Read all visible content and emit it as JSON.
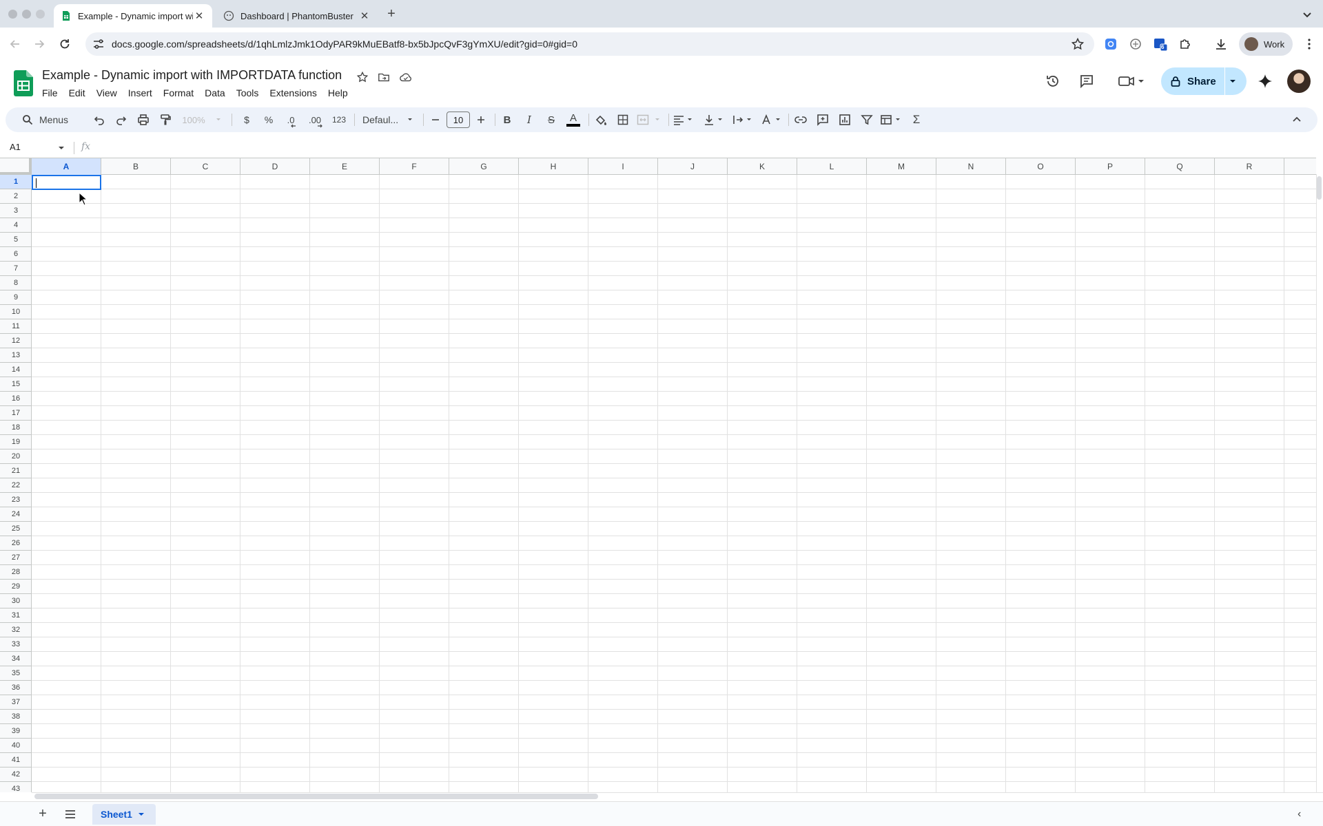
{
  "browser": {
    "tabs": [
      {
        "title": "Example - Dynamic import with IMPORTDATA function",
        "favicon": "sheets-favicon",
        "active": true
      },
      {
        "title": "Dashboard | PhantomBuster",
        "favicon": "phantombuster-favicon",
        "active": false
      }
    ],
    "new_tab_label": "+",
    "url": "docs.google.com/spreadsheets/d/1qhLmlzJmk1OdyPAR9kMuEBatf8-bx5bJpcQvF3gYmXU/edit?gid=0#gid=0",
    "profile_label": "Work",
    "extension_badge": "6"
  },
  "doc": {
    "title": "Example - Dynamic import with IMPORTDATA function",
    "menus": [
      "File",
      "Edit",
      "View",
      "Insert",
      "Format",
      "Data",
      "Tools",
      "Extensions",
      "Help"
    ],
    "share_label": "Share"
  },
  "toolbar": {
    "search_menus": "Menus",
    "zoom": "100%",
    "currency": "$",
    "percent": "%",
    "decrease_decimal": ".0",
    "increase_decimal": ".00",
    "number_format": "123",
    "font": "Defaul...",
    "font_size": "10",
    "bold": "B",
    "italic": "I",
    "strikethrough": "S",
    "text_color_letter": "A",
    "sum": "Σ"
  },
  "formula_bar": {
    "cell_ref": "A1",
    "fx_label": "fx"
  },
  "grid": {
    "columns": [
      "A",
      "B",
      "C",
      "D",
      "E",
      "F",
      "G",
      "H",
      "I",
      "J",
      "K",
      "L",
      "M",
      "N",
      "O",
      "P",
      "Q",
      "R"
    ],
    "rows": [
      "1",
      "2",
      "3",
      "4",
      "5",
      "6",
      "7",
      "8",
      "9",
      "10",
      "11",
      "12",
      "13",
      "14",
      "15",
      "16",
      "17",
      "18",
      "19",
      "20",
      "21",
      "22",
      "23",
      "24",
      "25",
      "26",
      "27",
      "28",
      "29",
      "30",
      "31",
      "32",
      "33",
      "34",
      "35",
      "36",
      "37",
      "38",
      "39",
      "40",
      "41",
      "42",
      "43"
    ],
    "selected_column": "A",
    "selected_row": "1"
  },
  "sheets": {
    "tabs": [
      {
        "name": "Sheet1",
        "active": true
      }
    ],
    "add_label": "+"
  },
  "colors": {
    "accent": "#1a73e8",
    "share_bg": "#c2e7ff",
    "toolbar_bg": "#edf2fa",
    "sheets_green": "#0f9d58"
  }
}
